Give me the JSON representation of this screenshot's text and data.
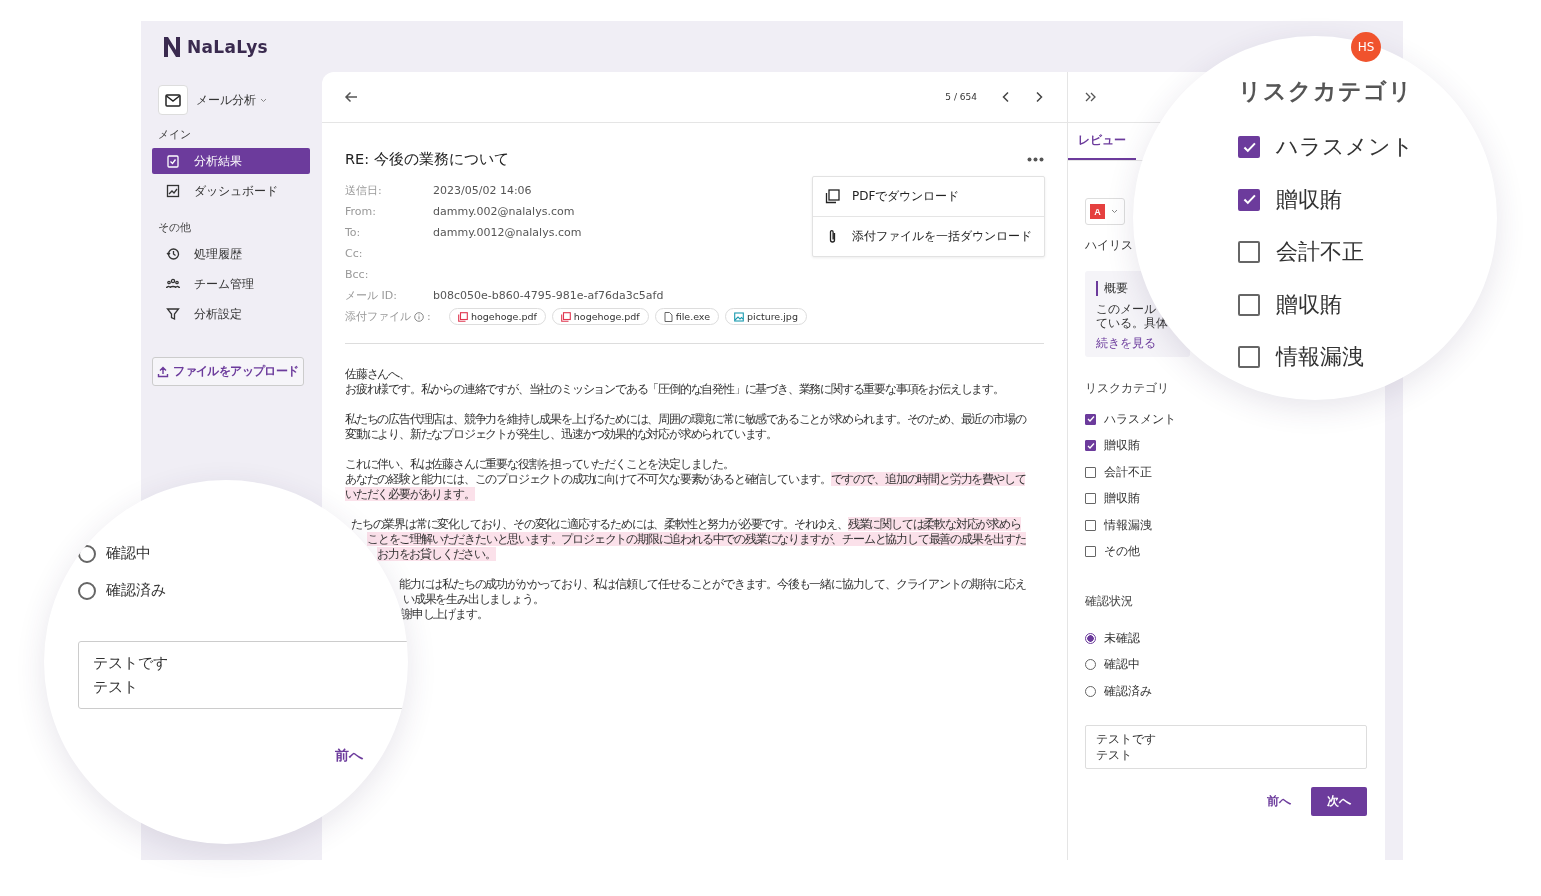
{
  "app": {
    "logo": "NaLaLys",
    "avatar": "HS"
  },
  "sidebar": {
    "switcher": "メール分析",
    "sections": [
      {
        "heading": "メイン",
        "items": [
          {
            "label": "分析結果",
            "selected": true
          },
          {
            "label": "ダッシュボード",
            "selected": false
          }
        ]
      },
      {
        "heading": "その他",
        "items": [
          {
            "label": "処理履歴",
            "selected": false
          },
          {
            "label": "チーム管理",
            "selected": false
          },
          {
            "label": "分析設定",
            "selected": false
          }
        ]
      }
    ],
    "upload_button": "ファイルをアップロード"
  },
  "email": {
    "counter": "5 / 654",
    "subject": "RE: 今後の業務について",
    "fields": [
      {
        "label": "送信日:",
        "value": "2023/05/02 14:06"
      },
      {
        "label": "From:",
        "value": "dammy.002@nalalys.com"
      },
      {
        "label": "To:",
        "value": "dammy.0012@nalalys.com"
      },
      {
        "label": "Cc:"
      },
      {
        "label": "Bcc:"
      },
      {
        "label": "メール ID:",
        "value": "b08c050e-b860-4795-981e-af76da3c5afd"
      }
    ],
    "attachments_label": "添付ファイル",
    "attachments_suffix": ":",
    "attachments": [
      {
        "name": "hogehoge.pdf",
        "kind": "pdf"
      },
      {
        "name": "hogehoge.pdf",
        "kind": "pdf"
      },
      {
        "name": "file.exe",
        "kind": "file"
      },
      {
        "name": "picture.jpg",
        "kind": "image"
      }
    ],
    "menu": [
      "PDFでダウンロード",
      "添付ファイルを一括ダウンロード"
    ],
    "body": [
      [
        [
          {
            "text": "佐藤さんへ、",
            "highlighted": false
          }
        ],
        [
          {
            "text": "お疲れ様です。私からの連絡ですが、当社のミッションである「圧倒的な自発性」に基づき、業務に関する重要な事項をお伝えします。",
            "highlighted": false
          }
        ]
      ],
      [
        [
          {
            "text": "私たちの広告代理店は、競争力を維持し成果を上げるためには、周囲の環境に常に敏感であることが求められます。そのため、最近の市場の",
            "highlighted": false
          }
        ],
        [
          {
            "text": "変動により、新たなプロジェクトが発生し、迅速かつ効果的な対応が求められています。",
            "highlighted": false
          }
        ]
      ],
      [
        [
          {
            "text": "これに伴い、私は佐藤さんに重要な役割を担っていただくことを決定しました。",
            "highlighted": false
          }
        ],
        [
          {
            "text": "あなたの経験と能力には、このプロジェクトの成功に向けて不可欠な要素があると確信しています。",
            "highlighted": false
          },
          {
            "text": "ですので、追加の時間と労力を費やして",
            "highlighted": true
          }
        ],
        [
          {
            "text": "いただく必要があります。",
            "highlighted": true
          }
        ]
      ],
      [
        [
          {
            "text": "たちの業界は常に変化しており、その変化に適応するためには、柔軟性と努力が必要です。それゆえ、",
            "highlighted": false
          },
          {
            "text": "残業に関しては柔軟な対応が求めら",
            "highlighted": true
          }
        ],
        [
          {
            "text": "ことをご理解いただきたいと思います。プロジェクトの期限に追われる中での残業になりますが、チームと協力して最善の成果を出すた",
            "highlighted": true
          }
        ],
        [
          {
            "text": "お力をお貸しください。",
            "highlighted": true
          }
        ]
      ],
      [
        [
          {
            "text": "能力には私たちの成功がかかっており、私は信頼して任せることができます。今後も一緒に協力して、クライアントの期待に応え",
            "highlighted": false
          }
        ],
        [
          {
            "text": "い成果を生み出しましょう。",
            "highlighted": false
          }
        ],
        [
          {
            "text": "謝申し上げます。",
            "highlighted": false
          }
        ]
      ]
    ]
  },
  "review": {
    "tabs": [
      {
        "label": "レビュー",
        "selected": true
      }
    ],
    "level_badge": "A",
    "high_risk_label": "ハイリス",
    "summary": {
      "heading": "概要",
      "lines": [
        "このメール",
        "ている。具体"
      ],
      "more_link": "続きを見る"
    },
    "risk_heading": "リスクカテゴリ",
    "risk_categories": [
      {
        "label": "ハラスメント",
        "checked": true
      },
      {
        "label": "贈収賄",
        "checked": true
      },
      {
        "label": "会計不正",
        "checked": false
      },
      {
        "label": "贈収賄",
        "checked": false
      },
      {
        "label": "情報漏洩",
        "checked": false
      },
      {
        "label": "その他",
        "checked": false
      }
    ],
    "status_heading": "確認状況",
    "statuses": [
      {
        "label": "未確認",
        "selected": true
      },
      {
        "label": "確認中",
        "selected": false
      },
      {
        "label": "確認済み",
        "selected": false
      }
    ],
    "comment": [
      "テストです",
      "テスト"
    ],
    "prev_button": "前へ",
    "next_button": "次へ"
  },
  "magnifiers": [
    {
      "kind": "checklist",
      "heading": "リスクカテゴリ",
      "items": [
        {
          "label": "ハラスメント",
          "checked": true
        },
        {
          "label": "贈収賄",
          "checked": true
        },
        {
          "label": "会計不正",
          "checked": false
        },
        {
          "label": "贈収賄",
          "checked": false
        },
        {
          "label": "情報漏洩",
          "checked": false
        }
      ]
    },
    {
      "kind": "form",
      "statuses": [
        {
          "label": "確認中",
          "selected": false
        },
        {
          "label": "確認済み",
          "selected": false
        }
      ],
      "comment": [
        "テストです",
        "テスト"
      ],
      "prev_button": "前へ"
    }
  ]
}
